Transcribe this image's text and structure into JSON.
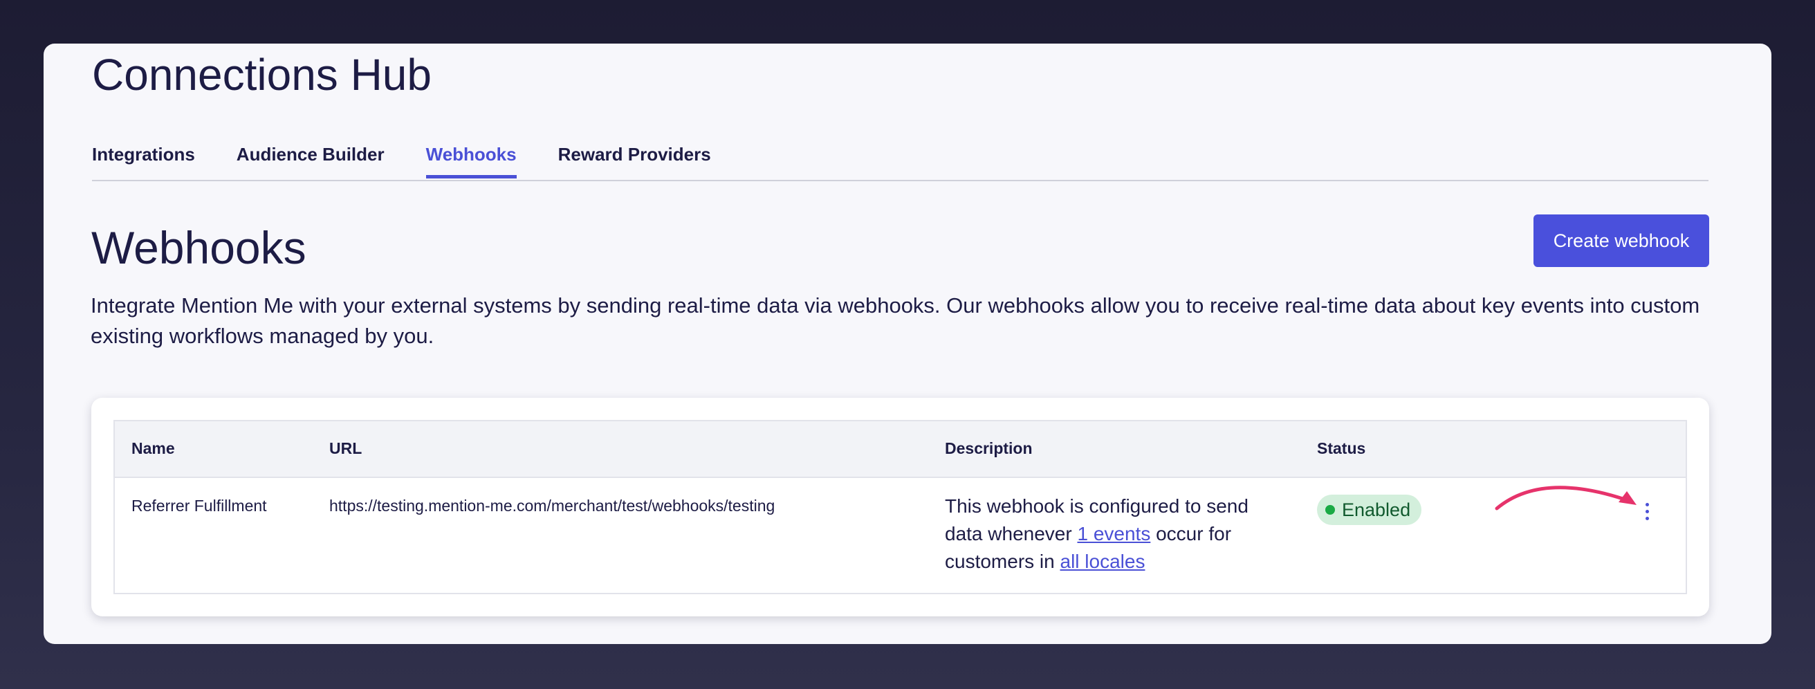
{
  "hub": {
    "title": "Connections Hub"
  },
  "tabs": [
    {
      "label": "Integrations",
      "active": false
    },
    {
      "label": "Audience Builder",
      "active": false
    },
    {
      "label": "Webhooks",
      "active": true
    },
    {
      "label": "Reward Providers",
      "active": false
    }
  ],
  "page": {
    "title": "Webhooks",
    "create_button": "Create webhook",
    "intro": "Integrate Mention Me with your external systems by sending real-time data via webhooks. Our webhooks allow you to receive real-time data about key events into custom existing workflows managed by you."
  },
  "table": {
    "columns": [
      "Name",
      "URL",
      "Description",
      "Status"
    ],
    "rows": [
      {
        "name": "Referrer Fulfillment",
        "url": "https://testing.mention-me.com/merchant/test/webhooks/testing",
        "description": {
          "part1": "This webhook is configured to send data whenever ",
          "events_link": "1 events",
          "part2": " occur for customers in ",
          "locales_link": "all locales"
        },
        "status": "Enabled"
      }
    ]
  },
  "colors": {
    "accent": "#4a50d6",
    "status_enabled_bg": "#d3efdc",
    "status_enabled_dot": "#1aaa45",
    "annotation_arrow": "#e6336b"
  },
  "icons": {
    "row_menu": "kebab-menu-icon",
    "annotation": "curved-arrow-icon"
  }
}
